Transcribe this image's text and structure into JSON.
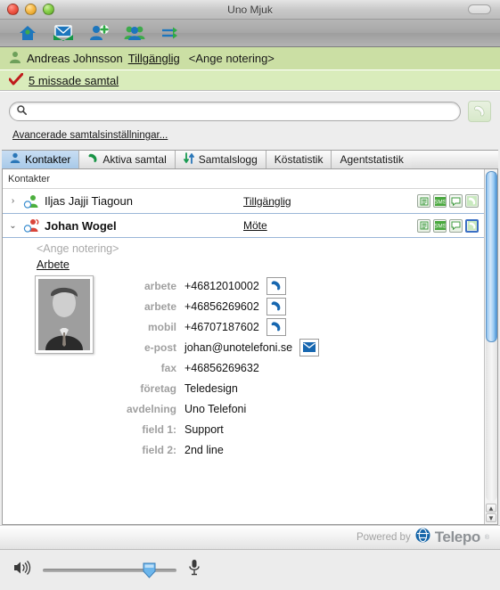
{
  "window": {
    "title": "Uno Mjuk",
    "controls": [
      "close",
      "minimize",
      "zoom"
    ]
  },
  "toolbar": {
    "buttons": [
      {
        "name": "home-icon",
        "label": "Hem"
      },
      {
        "name": "mail-icon",
        "label": "Meddelande"
      },
      {
        "name": "add-contact-icon",
        "label": "Lägg till kontakt"
      },
      {
        "name": "group-icon",
        "label": "Grupper"
      },
      {
        "name": "transfer-icon",
        "label": "Vidarekoppling"
      }
    ]
  },
  "user_status": {
    "name": "Andreas Johnsson",
    "presence": "Tillgänglig",
    "note_placeholder": "<Ange notering>"
  },
  "missed": {
    "label": "5 missade samtal",
    "count": 5
  },
  "search": {
    "value": "",
    "placeholder": "",
    "call_button_label": "Ring"
  },
  "advanced_link": "Avancerade samtalsinställningar...",
  "tabs": [
    {
      "label": "Kontakter",
      "icon": "person-icon",
      "active": true
    },
    {
      "label": "Aktiva samtal",
      "icon": "phone-icon",
      "active": false
    },
    {
      "label": "Samtalslogg",
      "icon": "arrows-updown-icon",
      "active": false
    },
    {
      "label": "Köstatistik",
      "icon": "",
      "active": false
    },
    {
      "label": "Agentstatistik",
      "icon": "",
      "active": false
    }
  ],
  "list": {
    "section_header": "Kontakter",
    "row_actions": [
      "notes-icon",
      "sms-icon",
      "chat-icon",
      "call-icon"
    ],
    "contacts": [
      {
        "name": "Iljas Jajji Tiagoun",
        "status": "Tillgänglig",
        "presence_color": "#4caf3d",
        "expanded": false,
        "twisty": "›"
      },
      {
        "name": "Johan Wogel",
        "status": "Möte",
        "presence_color": "#d9453a",
        "expanded": true,
        "twisty": "⌄"
      }
    ]
  },
  "detail": {
    "note_placeholder": "<Ange notering>",
    "group_label": "Arbete",
    "photo_alt": "Johan Wogel porträtt",
    "contact_fields": [
      {
        "label": "arbete",
        "value": "+46812010002",
        "action": "call-icon"
      },
      {
        "label": "arbete",
        "value": "+46856269602",
        "action": "call-icon"
      },
      {
        "label": "mobil",
        "value": "+46707187602",
        "action": "call-icon"
      },
      {
        "label": "e-post",
        "value": "johan@unotelefoni.se",
        "action": "mail-icon"
      },
      {
        "label": "fax",
        "value": "+46856269632",
        "action": ""
      },
      {
        "label": "företag",
        "value": "Teledesign",
        "action": ""
      },
      {
        "label": "avdelning",
        "value": "Uno Telefoni",
        "action": ""
      },
      {
        "label": "field 1:",
        "value": "Support",
        "action": ""
      },
      {
        "label": "field 2:",
        "value": "2nd line",
        "action": ""
      }
    ]
  },
  "footer": {
    "powered_by": "Powered by",
    "brand": "Telepo",
    "trademark": "®"
  },
  "volume": {
    "speaker_icon": "speaker-icon",
    "mic_icon": "microphone-icon",
    "level": 75
  },
  "colors": {
    "status_bar": "#cbdfa4",
    "status_bar_alt": "#d9ecbb",
    "tab_active": "#a8c9e8",
    "available": "#4caf3d",
    "busy": "#d9453a",
    "scroll_thumb": "#4e96d8"
  }
}
